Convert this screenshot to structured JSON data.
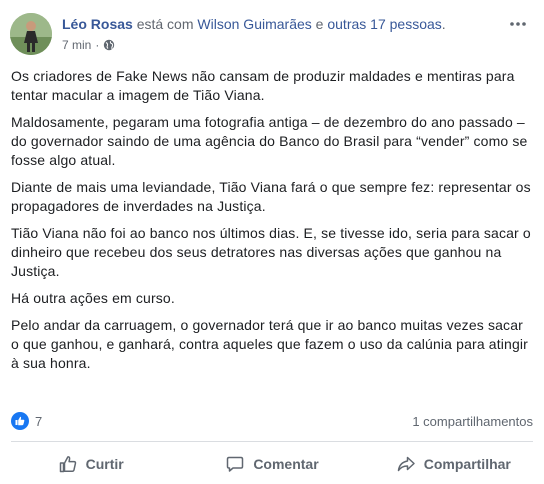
{
  "post": {
    "author": "Léo Rosas",
    "with_text": " está com ",
    "tagged": "Wilson Guimarães",
    "and_text": " e ",
    "others": "outras 17 pessoas",
    "period": ".",
    "time": "7 min",
    "separator": "·",
    "paragraphs": [
      "Os criadores de Fake News não cansam de produzir maldades e mentiras para tentar macular a imagem de Tião Viana.",
      "Maldosamente, pegaram uma fotografia antiga – de dezembro do ano passado – do governador saindo de uma agência do Banco do Brasil para “vender” como se fosse algo atual.",
      "Diante de mais uma leviandade, Tião Viana fará o que sempre fez: representar os propagadores de inverdades na Justiça.",
      "Tião Viana não foi ao banco nos últimos dias. E, se tivesse ido, seria para sacar o dinheiro que recebeu dos seus detratores nas diversas ações que ganhou na Justiça.",
      "Há outra ações em curso.",
      "Pelo andar da carruagem, o governador terá que ir ao banco muitas vezes sacar o que ganhou, e ganhará, contra aqueles que fazem o uso da calúnia para atingir à sua honra."
    ]
  },
  "stats": {
    "likes": "7",
    "shares": "1 compartilhamentos"
  },
  "actions": {
    "like": "Curtir",
    "comment": "Comentar",
    "share": "Compartilhar"
  },
  "icons": {
    "privacy": "globe-icon",
    "more": "more-options-icon",
    "like_badge": "thumbs-up-icon",
    "like": "thumbs-up-outline-icon",
    "comment": "speech-bubble-icon",
    "share": "share-arrow-icon"
  },
  "colors": {
    "link": "#385898",
    "meta": "#616770",
    "like_blue": "#1877f2",
    "action_gray": "#606770"
  }
}
